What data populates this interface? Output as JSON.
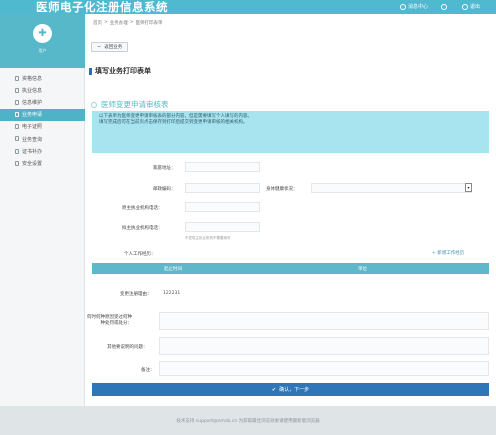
{
  "header": {
    "app_title": "医师电子化注册信息系统",
    "message_label": "消息中心",
    "user_label": "",
    "logout_label": "退出"
  },
  "sidebar": {
    "user_name": "用户",
    "items": [
      {
        "label": "资格信息",
        "icon": "document-icon"
      },
      {
        "label": "执业信息",
        "icon": "doctor-icon"
      },
      {
        "label": "信息维护",
        "icon": "edit-icon"
      },
      {
        "label": "业务申请",
        "icon": "apply-icon",
        "active": true
      },
      {
        "label": "电子证照",
        "icon": "certificate-icon"
      },
      {
        "label": "业务查询",
        "icon": "search-icon"
      },
      {
        "label": "证书补办",
        "icon": "reissue-icon"
      },
      {
        "label": "安全设置",
        "icon": "lock-icon"
      }
    ]
  },
  "breadcrumb": [
    "首页",
    ">",
    "业务办理",
    ">",
    "医师打印表单"
  ],
  "back_button": "返回业务",
  "page_title": "填写业务打印表单",
  "card": {
    "title": "医师变更申请审核表",
    "notice_line1": "以下表单为医师变更申请审核表的部分内容，但是需要填写个人填写的内容。",
    "notice_line2": "填写完成后可在当前页点击保存到打印后提交到变更申请审核的相关机构。"
  },
  "form": {
    "address_label": "家庭地址：",
    "postcode_label": "邮政编码：",
    "health_label": "身体健康状况：",
    "original_org_phone_label": "原主执业机构电话：",
    "new_org_phone_label": "拟主执业机构电话：",
    "phone_hint": "不发现主执业机构不需要填写",
    "work_history_label": "个人工作经历：",
    "add_work_link": "+ 新增工作经历",
    "table_col_time": "起止时间",
    "table_col_unit": "单位",
    "reg_number_label": "变更注册理由：",
    "reg_number_value": "122231",
    "penalty_label_line1": "何时何种原因受过何种",
    "penalty_label_line2": "种处罚或处分：",
    "other_label": "其他要说明的问题：",
    "remark_label": "备注：",
    "submit_label": "确认，下一步"
  },
  "footer": {
    "text": "技术支持 support@nmda.cn 为获取最佳浏览效果请使用最新版浏览器"
  },
  "colors": {
    "header": "#4fb9cf",
    "active_nav": "#4fb3c7",
    "notice_bg": "#a8e4ef",
    "submit_bg": "#2f76b8",
    "table_head": "#5fb7ca"
  }
}
